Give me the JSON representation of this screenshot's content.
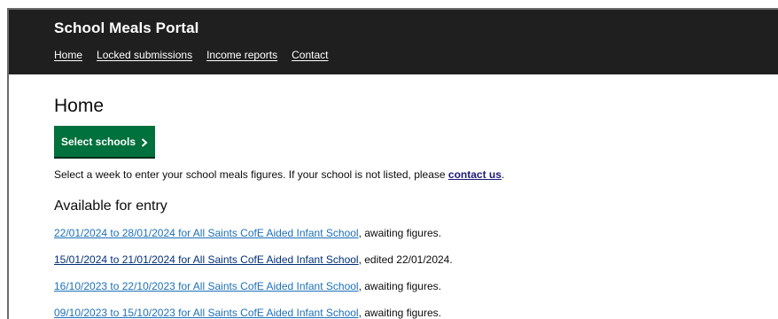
{
  "header": {
    "service_name": "School Meals Portal",
    "nav": [
      "Home",
      "Locked submissions",
      "Income reports",
      "Contact"
    ]
  },
  "main": {
    "title": "Home",
    "select_button": "Select schools",
    "intro_text": "Select a week to enter your school meals figures. If your school is not listed, please ",
    "intro_link": "contact us",
    "intro_end": ".",
    "section_heading": "Available for entry",
    "entries": [
      {
        "link": "22/01/2024 to 28/01/2024 for All Saints CofE Aided Infant School",
        "status": ", awaiting figures."
      },
      {
        "link": "15/01/2024 to 21/01/2024 for All Saints CofE Aided Infant School",
        "status": ", edited 22/01/2024."
      },
      {
        "link": "16/10/2023 to 22/10/2023 for All Saints CofE Aided Infant School",
        "status": ", awaiting figures."
      },
      {
        "link": "09/10/2023 to 15/10/2023 for All Saints CofE Aided Infant School",
        "status": ", awaiting figures."
      }
    ]
  },
  "icons": {
    "select_button_icon": "chevron-right-icon"
  },
  "colors": {
    "header_bg": "#1f1f1f",
    "button_bg": "#00703c",
    "link": "#1d70b8"
  }
}
